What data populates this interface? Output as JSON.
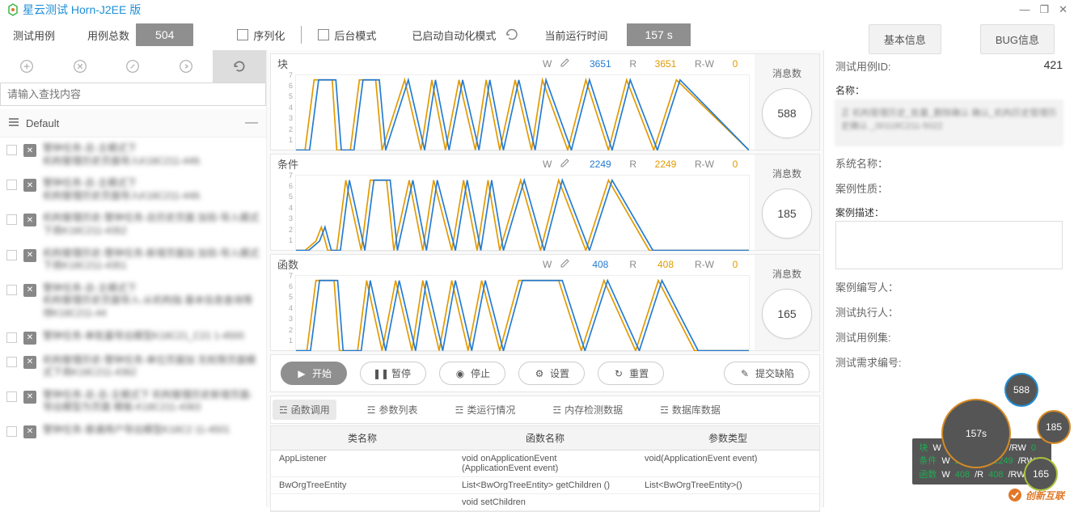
{
  "title": "星云测试 Horn-J2EE 版",
  "topbar": {
    "tab_test_cases": "测试用例",
    "total_cases_label": "用例总数",
    "total_cases_value": "504",
    "serialize_label": "序列化",
    "background_label": "后台模式",
    "auto_mode_label": "已启动自动化模式",
    "runtime_label": "当前运行时间",
    "runtime_value": "157 s"
  },
  "right_tabs": {
    "basic": "基本信息",
    "bug": "BUG信息"
  },
  "left": {
    "search_placeholder": "请输入查找内容",
    "default_group": "Default",
    "items": [
      {
        "l1": "警钟任务-总-主模式下",
        "l2": "机构管理历史页面导入K18C211-449."
      },
      {
        "l1": "警钟任务-总-主模式下",
        "l2": "机构管理历史页面导入K18C211-449."
      },
      {
        "l1": "机构管理历史-警钟任务-总历史页面\n加验-导入模式下商K18C211-4352"
      },
      {
        "l1": "机构管理历史-警钟任务-新增页面加\n加验-导入模式下商K18C211-4351"
      },
      {
        "l1": "警钟任务-总-主模式下",
        "l2": "机构管理历史页面导入-从机构指\n基本信息查询等待K18C211-44"
      },
      {
        "l1": "警钟任务-单批量导出模型K18C21_C21\n1-4500"
      },
      {
        "l1": "机构管理历史-警钟任务-单位页面加\n无权限页面模式下商K18C211-4362"
      },
      {
        "l1": "警钟任务-总-总-主模式下\n机构管理历史新增页面-导出模型为页面\n模板-K18C211-4363"
      },
      {
        "l1": "警钟任务-普通用户导出模型K18C2\n11-4501"
      }
    ]
  },
  "charts": [
    {
      "title": "块",
      "W": "3651",
      "R": "3651",
      "RW": "0",
      "msg_label": "消息数",
      "msg_value": "588"
    },
    {
      "title": "条件",
      "W": "2249",
      "R": "2249",
      "RW": "0",
      "msg_label": "消息数",
      "msg_value": "185"
    },
    {
      "title": "函数",
      "W": "408",
      "R": "408",
      "RW": "0",
      "msg_label": "消息数",
      "msg_value": "165"
    }
  ],
  "chart_data": [
    {
      "type": "line",
      "title": "块",
      "series_labels": [
        "W",
        "R"
      ],
      "ylim": [
        0,
        7
      ],
      "yticks": [
        1,
        2,
        3,
        4,
        5,
        6,
        7
      ]
    },
    {
      "type": "line",
      "title": "条件",
      "series_labels": [
        "W",
        "R"
      ],
      "ylim": [
        0,
        7
      ],
      "yticks": [
        1,
        2,
        3,
        4,
        5,
        6,
        7
      ]
    },
    {
      "type": "line",
      "title": "函数",
      "series_labels": [
        "W",
        "R"
      ],
      "ylim": [
        0,
        7
      ],
      "yticks": [
        1,
        2,
        3,
        4,
        5,
        6,
        7
      ]
    }
  ],
  "actions": {
    "start": "开始",
    "pause": "暂停",
    "stop": "停止",
    "settings": "设置",
    "reset": "重置",
    "defect": "提交缺陷"
  },
  "data_tabs": {
    "fn_call": "函数调用",
    "params": "参数列表",
    "run_status": "类运行情况",
    "mem": "内存检测数据",
    "db": "数据库数据"
  },
  "table": {
    "headers": {
      "class": "类名称",
      "func": "函数名称",
      "param": "参数类型"
    },
    "rows": [
      {
        "class": "AppListener",
        "func": "void onApplicationEvent (ApplicationEvent event)",
        "param": "void(ApplicationEvent event)"
      },
      {
        "class": "BwOrgTreeEntity",
        "func": "List<BwOrgTreeEntity> getChildren ()",
        "param": "List<BwOrgTreeEntity>()"
      },
      {
        "class": "",
        "func": "void setChildren",
        "param": ""
      }
    ]
  },
  "info": {
    "id_label": "测试用例ID:",
    "id_value": "421",
    "name_label": "名称：",
    "name_text": "正 机构管理历史_批量_删除确认 确认_机构历史管理历史确认 _00118C211-5022",
    "sys_label": "系统名称：",
    "nature_label": "案例性质：",
    "desc_label": "案例描述：",
    "author_label": "案例编写人：",
    "exec_label": "测试执行人：",
    "caseset_label": "测试用例集:",
    "req_label": "测试需求编号:"
  },
  "float": {
    "rows": [
      {
        "n": "块",
        "w": "3651",
        "r": "3651",
        "rw": "0"
      },
      {
        "n": "条件",
        "w": "2249",
        "r": "2249",
        "rw": "0"
      },
      {
        "n": "函数",
        "w": "408",
        "r": "408",
        "rw": "0"
      }
    ],
    "main_bubble": "157s",
    "b1": "588",
    "b2": "185",
    "b3": "165"
  },
  "watermark": "创新互联"
}
